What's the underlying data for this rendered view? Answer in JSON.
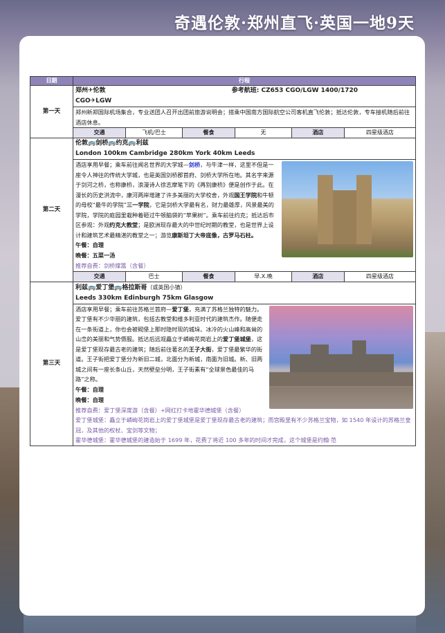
{
  "banner": "奇遇伦敦·郑州直飞·英国一地9天",
  "header": {
    "col_date": "日期",
    "col_trip": "行程"
  },
  "days": [
    {
      "label": "第一天",
      "route": "郑州✈伦敦",
      "flight_label": "参考航班: CZ653 CGO/LGW 1400/1720",
      "route_code": "CGO✈LGW",
      "desc": "郑州新郑国际机场集合，专业送团人召开出团前旅游说明会；搭乘中国南方国际航空公司客机直飞伦敦；抵达伦敦，专车接机随后前往酒店休息。",
      "info": {
        "transport_label": "交通",
        "transport": "飞机/巴士",
        "meal_label": "餐食",
        "meal": "无",
        "hotel_label": "酒店",
        "hotel": "四星级酒店"
      }
    },
    {
      "label": "第二天",
      "route": "伦敦🚌剑桥🚌约克🚌利兹",
      "route_en": "London 100km Cambridge 280km York 40km Leeds",
      "p1": "酒店享用早餐；乘车前往闻名世界的大学城—",
      "p1_b": "剑桥",
      "p2": "，与牛津一样，这里不但是一座令人神往的传统大学城，也是英国剑桥郡首府、剑桥大学所在地。其名字来源于剑河之桥，也称康桥，浪漫诗人徐志摩笔下的《再别康桥》便是创作于此。在漫长的历史洪流中，康河两岸增建了许多美丽的大学校舍，外观",
      "p2_b": "国王学院",
      "p3": "和牛顿的母校“最牛的学院”",
      "p3_b": "三一学院",
      "p4": "，它是剑桥大学最有名，财力最雄厚，风景最美的学院，学院的庭园里栽种着砸过牛顿脑袋的“苹果树”。乘车前往约克；抵达后市区参观：外观",
      "p4_b": "约克大教堂",
      "p5": "；是欧洲现存最大的中世纪时期的教堂，也是世界上设计和建筑艺术最精湛的教堂之一；游览",
      "p5_b": "康斯坦丁大帝底像，古罗马石柱。",
      "lunch": "午餐：自理",
      "dinner": "晚餐：五菜一汤",
      "recommend": "推荐自费：剑桥撑篙（含餐）",
      "info": {
        "transport_label": "交通",
        "transport": "巴士",
        "meal_label": "餐食",
        "meal": "早.X.晚",
        "hotel_label": "酒店",
        "hotel": "四星级酒店"
      }
    },
    {
      "label": "第三天",
      "route": "利兹🚌爱丁堡🚌格拉斯哥",
      "route_note": "（或英国小镇）",
      "route_en": "Leeds 330km Edinburgh 75km Glasgow",
      "p1": "酒店享用早餐；乘车前往苏格兰首府—",
      "p1_b": "爱丁堡",
      "p2": "，充满了苏格兰独特的魅力。爱丁堡有不少华丽的建筑，包括古教堂和维多利亚时代的建筑杰作。随便走在一条街道上，你也会被砌堡上那时隐时现的城垛、冰冷的火山峰和高耸的山峦的美丽和气势慑服。抵达后远观矗立于嶙峋花岗岩上的",
      "p2_b": "爱丁堡城堡",
      "p3": "，这是爱丁堡现存最古老的建筑；随后前往著名的",
      "p3_b": "王子大街",
      "p4": "，爱丁堡最繁华的街道。王子街把爱丁堡分为新旧二城，北面分为新城，南面为旧城。新、旧两城之间有一座长条山丘，天然壁垒分明，王子街素有“全球景色最佳的马路”之称。",
      "lunch": "午餐：自理",
      "dinner": "晚餐：自理",
      "recommend": "推荐自费：爱丁堡深度游（含餐）+网红打卡地霍华德城堡（含餐）",
      "opt1": "爱丁堡城堡：矗立于嶙峋花岗岩上的爱丁堡城堡是爱丁堡现存最古老的建筑；而宫殿里有不少苏格兰宝物，如 1540 年设计的苏格兰皇冠，及其他的权杖、宝剑等文物；",
      "opt2": "霍华德城堡：霍华德城堡的建造始于 1699 年，花费了将近 100 多年的时间才完成，这个城堡是约翰·范"
    }
  ]
}
